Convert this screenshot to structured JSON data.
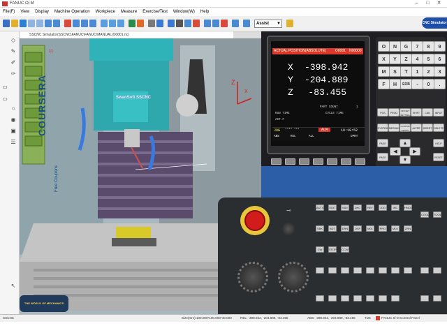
{
  "window": {
    "title": "FANUC Oi M"
  },
  "menu": [
    "File(F)",
    "View",
    "Display",
    "Machine Operation",
    "Workpiece",
    "Measure",
    "Exercise/Test",
    "Window(W)",
    "Help"
  ],
  "toolbar": {
    "mode_value": "Assist",
    "brand": "CNC Simulator"
  },
  "viewport": {
    "title": "SSCNC Simulator(SSCNC\\FANUC\\FANUC\\MANUAL\\O0001.nc)",
    "brand_logo": "SwanSoft SSCNC",
    "watermark_main": "COURSERA",
    "watermark_small": "Free Coupons",
    "bottom_logo": "THE WORLD OF MECHANICS"
  },
  "cnc_screen": {
    "title": "ACTUAL POSITION(ABSOLUTE)",
    "program": "O0001",
    "block": "N00000",
    "x_label": "X",
    "x_value": "-398.942",
    "y_label": "Y",
    "y_value": "-204.889",
    "z_label": "Z",
    "z_value": "-83.455",
    "part_count_label": "PART COUNT",
    "part_count": "1",
    "run_time_label": "RUN TIME",
    "cycle_time_label": "CYCLE TIME",
    "actf_label": "ACT.F",
    "mode": "JOG",
    "stars": "****  ***",
    "alarm": "ALM",
    "clock": "19:18:52",
    "softkeys": [
      "ABS",
      "REL",
      "ALL",
      "",
      "OPRT"
    ]
  },
  "keypad": {
    "rows": [
      [
        "O",
        "N",
        "G",
        "7",
        "8",
        "9"
      ],
      [
        "X",
        "Y",
        "Z",
        "4",
        "5",
        "6"
      ],
      [
        "M",
        "S",
        "T",
        "1",
        "2",
        "3"
      ],
      [
        "F",
        "H",
        "EOB",
        "-",
        "0",
        "."
      ]
    ],
    "func_row1": [
      "POS",
      "PROG",
      "OFFSET SETTING",
      "SHIFT",
      "CAN",
      "INPUT"
    ],
    "func_row2": [
      "SYSTEM",
      "MESSAGE",
      "CUSTOM GRAPH",
      "ALTER",
      "INSERT",
      "DELETE"
    ],
    "nav_left": [
      "PAGE",
      "PAGE"
    ],
    "nav_right": "HELP",
    "reset": "RESET"
  },
  "machine_panel": {
    "buttons": [
      "AUTO",
      "EDIT",
      "MDI",
      "DNC",
      "REF",
      "JOG",
      "INC",
      "HNDL",
      "SBK",
      "BDT",
      "DRN",
      "OSP",
      "M01",
      "PRG",
      "MLK",
      "ZRN",
      "CW",
      "STOP",
      "CCW",
      "COOL",
      "TOOL"
    ]
  },
  "status": {
    "scale": "Size(mm):100.000*100.000*40.000",
    "rel": "REL: -398.942, -204.889, -83.455",
    "abs": "ABS: -398.942, -204.889, -83.455",
    "tool": "T:25",
    "panel": "FANUC 0i-M Control Panel",
    "left": "SSCNC"
  },
  "colors": {
    "accent": "#2b5ea7",
    "alarm": "#d83a2e",
    "estop": "#d11c1c"
  }
}
